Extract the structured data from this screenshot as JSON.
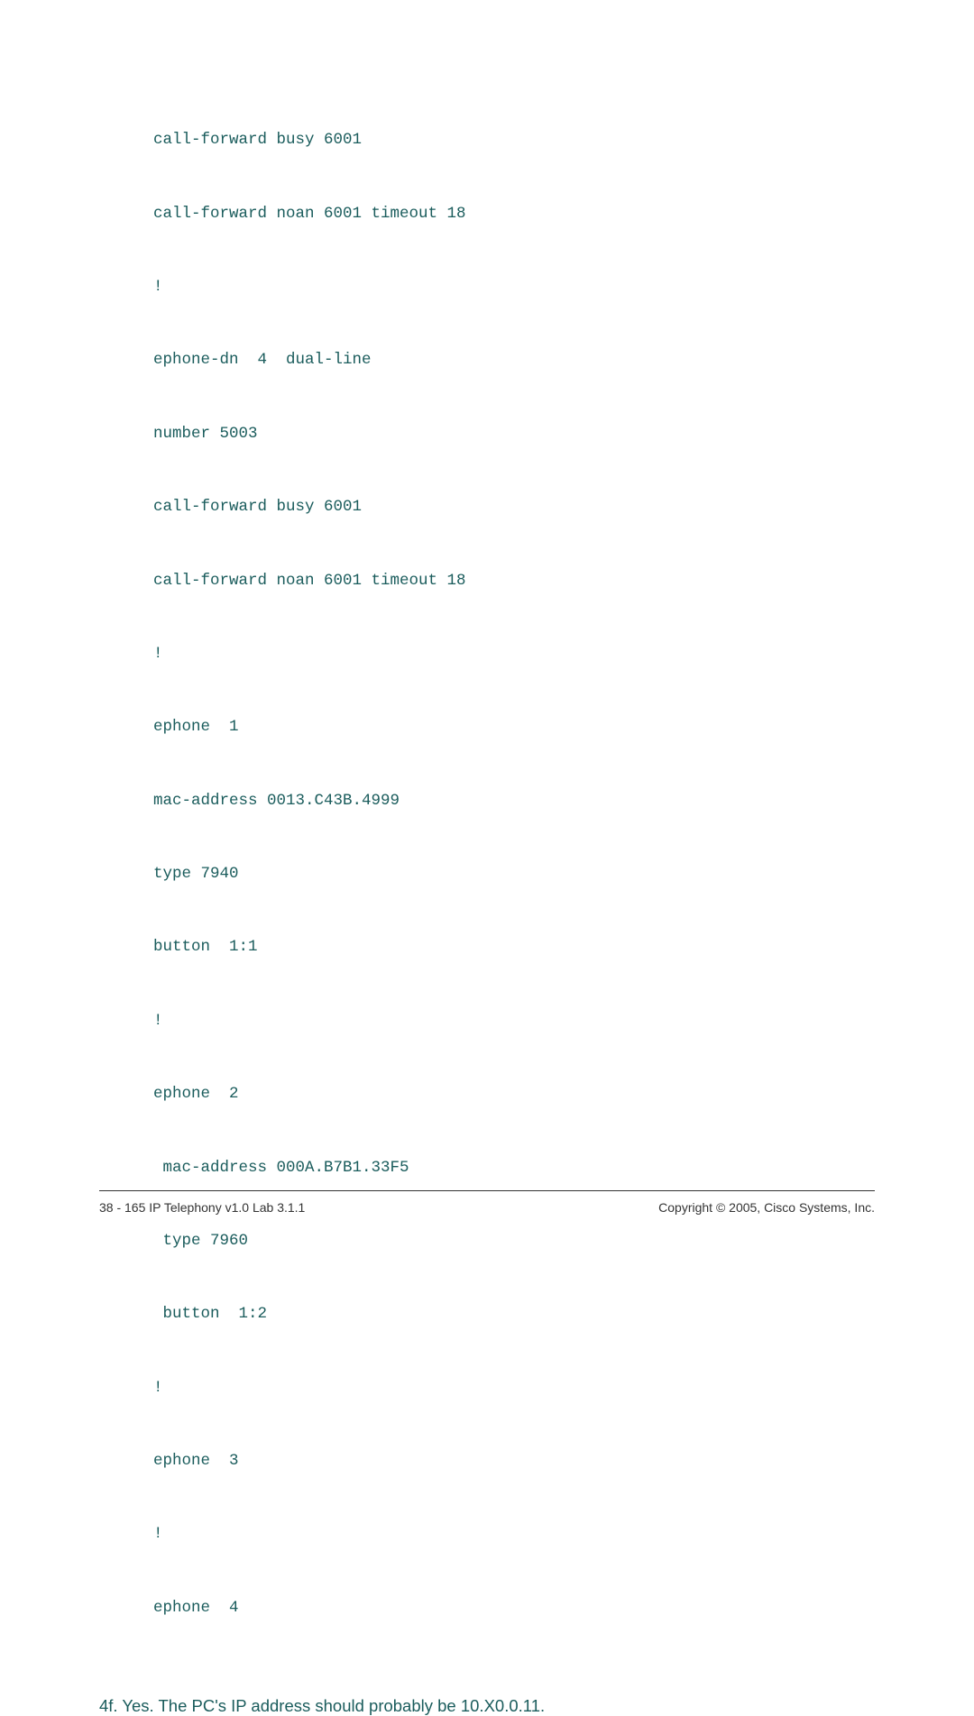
{
  "config": {
    "lines": [
      "call-forward busy 6001",
      "call-forward noan 6001 timeout 18",
      "!",
      "ephone-dn  4  dual-line",
      "number 5003",
      "call-forward busy 6001",
      "call-forward noan 6001 timeout 18",
      "!",
      "ephone  1",
      "mac-address 0013.C43B.4999",
      "type 7940",
      "button  1:1",
      "!",
      "ephone  2",
      " mac-address 000A.B7B1.33F5",
      " type 7960",
      " button  1:2",
      "!",
      "ephone  3",
      "!",
      "ephone  4"
    ]
  },
  "answer": "4f. Yes. The PC's IP address should probably be 10.X0.0.11.",
  "footer": {
    "left": "38 - 165   IP Telephony v1.0  Lab 3.1.1",
    "right": "Copyright © 2005, Cisco Systems, Inc."
  }
}
